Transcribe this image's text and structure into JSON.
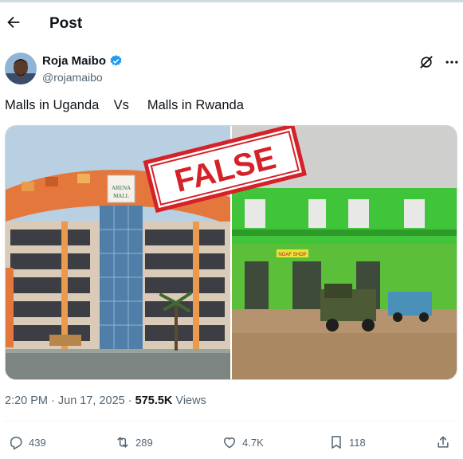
{
  "header": {
    "title": "Post",
    "back_icon": "arrow-left-icon"
  },
  "author": {
    "name": "Roja Maibo",
    "handle": "@rojamaibo",
    "verified_color": "#1d9bf0"
  },
  "tweet": {
    "text": "Malls in Uganda    Vs     Malls in Rwanda"
  },
  "media": {
    "stamp_text": "FALSE",
    "stamp_color": "#d42228",
    "sign_top": "ARENA",
    "sign_bottom": "MALL",
    "shop_sign": "NOAF SHOP"
  },
  "meta": {
    "time": "2:20 PM · Jun 17, 2025 · ",
    "views_count": "575.5K",
    "views_label": " Views"
  },
  "actions": {
    "replies": "439",
    "reposts": "289",
    "likes": "4.7K",
    "bookmarks": "118"
  }
}
